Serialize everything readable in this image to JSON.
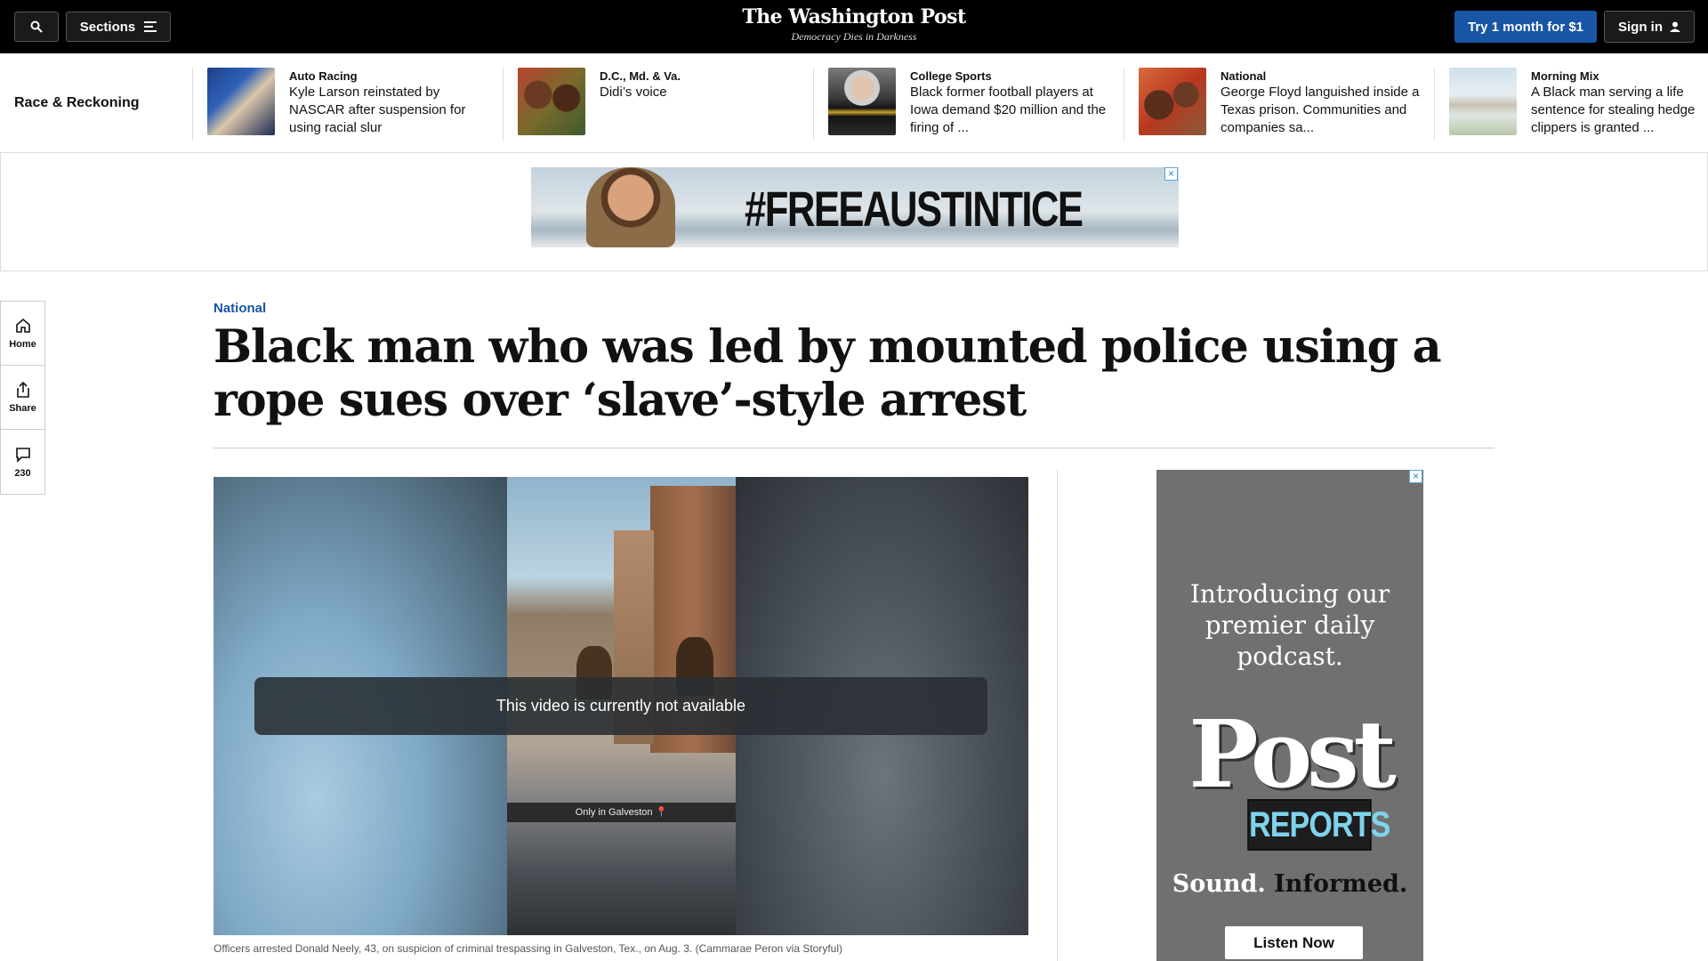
{
  "header": {
    "sections_label": "Sections",
    "logo": "The Washington Post",
    "tagline": "Democracy Dies in Darkness",
    "try_label": "Try 1 month for $1",
    "signin_label": "Sign in"
  },
  "rail": {
    "title": "Race & Reckoning",
    "items": [
      {
        "kicker": "Auto Racing",
        "headline": "Kyle Larson reinstated by NASCAR after suspension for using racial slur"
      },
      {
        "kicker": "D.C., Md. & Va.",
        "headline": "Didi’s voice"
      },
      {
        "kicker": "College Sports",
        "headline": "Black former football players at Iowa demand $20 million and the firing of ..."
      },
      {
        "kicker": "National",
        "headline": "George Floyd languished inside a Texas prison. Communities and companies sa..."
      },
      {
        "kicker": "Morning Mix",
        "headline": "A Black man serving a life sentence for stealing hedge clippers is granted ..."
      }
    ]
  },
  "top_ad": {
    "text": "#FREEAUSTINTICE",
    "close": "×"
  },
  "side_rail": {
    "home_label": "Home",
    "share_label": "Share",
    "comments_count": "230"
  },
  "article": {
    "kicker": "National",
    "headline": "Black man who was led by mounted police using a rope sues over ‘slave’-style arrest",
    "video_overlay_text": "This video is currently not available",
    "video_inframe_text": "Only in Galveston 📍",
    "caption": "Officers arrested Donald Neely, 43, on suspicion of criminal trespassing in Galveston, Tex., on Aug. 3. (Cammarae Peron via Storyful)"
  },
  "side_ad": {
    "intro": "Introducing our premier daily podcast.",
    "brand_top": "Post",
    "brand_bottom": "REPORTS",
    "tagline_a": "Sound.",
    "tagline_b": "Informed.",
    "cta": "Listen Now",
    "close": "×"
  },
  "colors": {
    "brand_blue": "#1955a5",
    "topbar": "#000000",
    "ad_gray": "#707070"
  }
}
